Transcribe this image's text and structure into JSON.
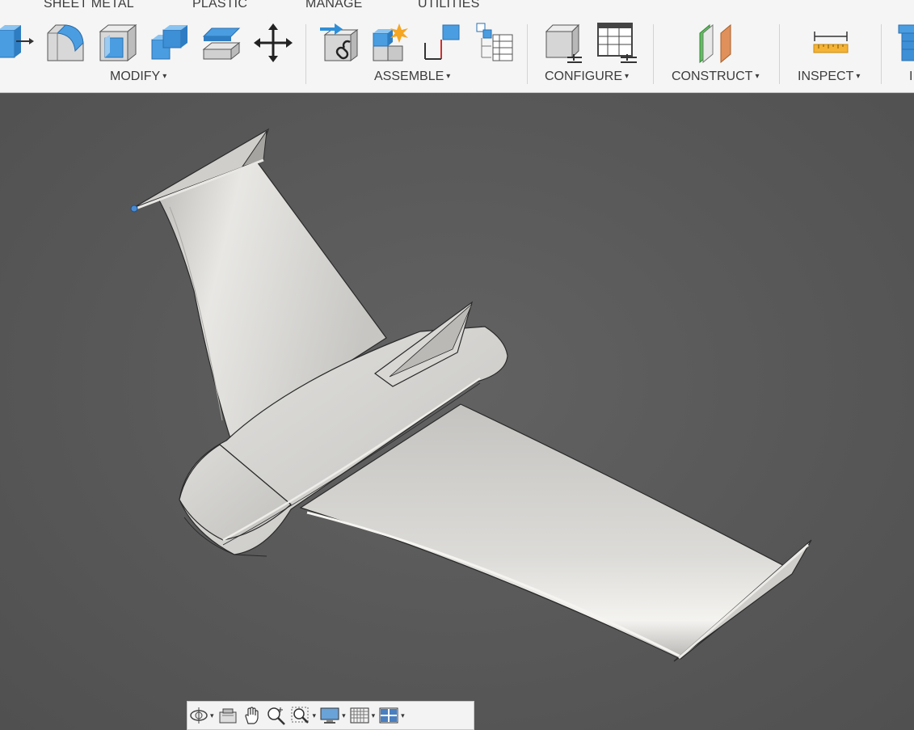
{
  "tabs": [
    "SHEET METAL",
    "PLASTIC",
    "MANAGE",
    "UTILITIES"
  ],
  "groups": {
    "modify": "MODIFY",
    "assemble": "ASSEMBLE",
    "configure": "CONFIGURE",
    "construct": "CONSTRUCT",
    "inspect": "INSPECT",
    "insert_partial": "I"
  },
  "caret": "▾",
  "modify_tools": [
    "press-pull-icon",
    "fillet-icon",
    "shell-icon",
    "combine-icon",
    "offset-face-icon",
    "move-copy-icon"
  ],
  "assemble_tools": [
    "new-component-icon",
    "joint-icon",
    "as-built-joint-icon",
    "rigid-group-icon"
  ],
  "configure_tools": [
    "configure-model-icon",
    "configure-table-icon"
  ],
  "construct_tools": [
    "offset-plane-icon"
  ],
  "inspect_tools": [
    "measure-icon"
  ],
  "navbar_tools": [
    "orbit-icon",
    "look-at-icon",
    "pan-icon",
    "zoom-icon",
    "fit-icon",
    "display-settings-icon",
    "grid-settings-icon",
    "viewports-icon"
  ],
  "colors": {
    "viewport_bg": "#5a5a5a",
    "ribbon_bg": "#f5f5f5",
    "accent_blue": "#2e8fd8",
    "model_surface": "#d4d3d0"
  }
}
